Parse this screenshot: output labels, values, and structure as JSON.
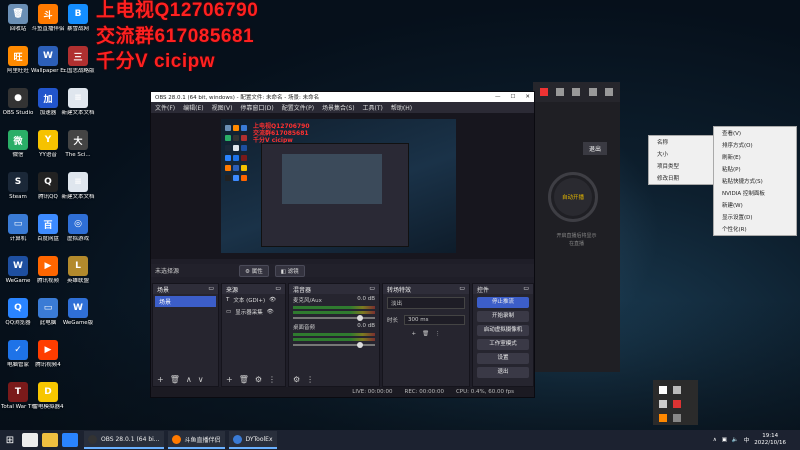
{
  "watermark": {
    "line1": "上电视Q12706790",
    "line2": "交流群617085681",
    "line3": "千分V cicipw"
  },
  "desktop_icons": [
    {
      "label": "回收站",
      "color": "#6a8fb5",
      "glyph": "🗑"
    },
    {
      "label": "阿里旺旺",
      "color": "#ff8a00",
      "glyph": "旺"
    },
    {
      "label": "OBS Studio",
      "color": "#333333",
      "glyph": "●"
    },
    {
      "label": "微信",
      "color": "#2aae67",
      "glyph": "微"
    },
    {
      "label": "Steam",
      "color": "#1b2838",
      "glyph": "S"
    },
    {
      "label": "计算机",
      "color": "#3a7bd5",
      "glyph": "▭"
    },
    {
      "label": "WeGame",
      "color": "#1e4fa0",
      "glyph": "W"
    },
    {
      "label": "QQ浏览器",
      "color": "#2a84ff",
      "glyph": "Q"
    },
    {
      "label": "电脑管家",
      "color": "#1e73e8",
      "glyph": "✓"
    },
    {
      "label": "Total War THREE KI...",
      "color": "#7a1a1a",
      "glyph": "T"
    },
    {
      "label": "斗鱼直播伴侣",
      "color": "#ff7a00",
      "glyph": "斗"
    },
    {
      "label": "Wallpaper Engine",
      "color": "#2c5fb8",
      "glyph": "W"
    },
    {
      "label": "加速器",
      "color": "#2255cc",
      "glyph": "加"
    },
    {
      "label": "YY语音",
      "color": "#f6c200",
      "glyph": "Y"
    },
    {
      "label": "腾讯QQ",
      "color": "#222222",
      "glyph": "Q"
    },
    {
      "label": "百度网盘",
      "color": "#3d8bff",
      "glyph": "百"
    },
    {
      "label": "腾讯视频",
      "color": "#ff6600",
      "glyph": "▶"
    },
    {
      "label": "此电脑",
      "color": "#3a7bd5",
      "glyph": "▭"
    },
    {
      "label": "腾讯视频4",
      "color": "#ff3d00",
      "glyph": "▶"
    },
    {
      "label": "雷电模拟器4",
      "color": "#f7c600",
      "glyph": "D"
    }
  ],
  "desktop_icons_col2": [
    {
      "label": "暴雪战网",
      "color": "#148eff",
      "glyph": "B"
    },
    {
      "label": "三国志战略版",
      "color": "#b03030",
      "glyph": "三"
    },
    {
      "label": "新建文本文档",
      "color": "#dfe6ee",
      "glyph": "≡"
    },
    {
      "label": "The Sci...",
      "color": "#444",
      "glyph": "大"
    },
    {
      "label": "新建文本文档",
      "color": "#dfe6ee",
      "glyph": "≡"
    },
    {
      "label": "虚拟游戏",
      "color": "#2f6fd6",
      "glyph": "◎"
    },
    {
      "label": "英雄联盟",
      "color": "#b38a2c",
      "glyph": "L"
    },
    {
      "label": "WeGame版",
      "color": "#2f6fd6",
      "glyph": "W"
    }
  ],
  "obs": {
    "title": "OBS 28.0.1 (64 bit, windows) - 配置文件: 未命名 - 场景: 未命名",
    "menu": [
      "文件(F)",
      "编辑(E)",
      "视图(V)",
      "停靠窗口(D)",
      "配置文件(P)",
      "场景集合(S)",
      "工具(T)",
      "帮助(H)"
    ],
    "no_source": "未选择源",
    "properties_btn": "属性",
    "filters_btn": "滤镜",
    "docks": {
      "scenes": {
        "title": "场景",
        "selected": "场景"
      },
      "sources": {
        "title": "来源",
        "items": [
          "文本 (GDI+)",
          "显示器采集"
        ]
      },
      "mixer": {
        "title": "混音器",
        "ch1": "麦克风/Aux",
        "ch1_db": "0.0 dB",
        "ch2": "桌面音频",
        "ch2_db": "0.0 dB"
      },
      "transitions": {
        "title": "转场特效",
        "type": "淡出",
        "duration_label": "时长",
        "duration": "300 ms"
      },
      "controls": {
        "title": "控件",
        "buttons": [
          "停止推流",
          "开始录制",
          "启动虚拟摄像机",
          "工作室模式",
          "设置",
          "退出"
        ]
      }
    },
    "status": {
      "live": "LIVE: 00:00:00",
      "rec": "REC: 00:00:00",
      "cpu": "CPU: 0.4%, 60.00 fps"
    }
  },
  "bgapp": {
    "btn": "退出",
    "circle": "自动开播",
    "hint1": "开启直播后将显示",
    "hint2": "在直播"
  },
  "menu1": [
    "查看(V)",
    "排序方式(O)",
    "刷新(E)",
    "粘贴(P)",
    "粘贴快捷方式(S)",
    "NVIDIA 控制面板",
    "新建(W)",
    "显示设置(D)",
    "个性化(R)"
  ],
  "menu2": [
    "名称",
    "大小",
    "项目类型",
    "修改日期"
  ],
  "taskbar": {
    "apps": [
      {
        "label": "OBS 28.0.1 (64 bi...",
        "color": "#333"
      },
      {
        "label": "斗鱼直播伴侣",
        "color": "#ff7a00"
      },
      {
        "label": "DYToolEx",
        "color": "#3a7bd5"
      }
    ],
    "time": "19:14",
    "date": "2022/10/16"
  }
}
